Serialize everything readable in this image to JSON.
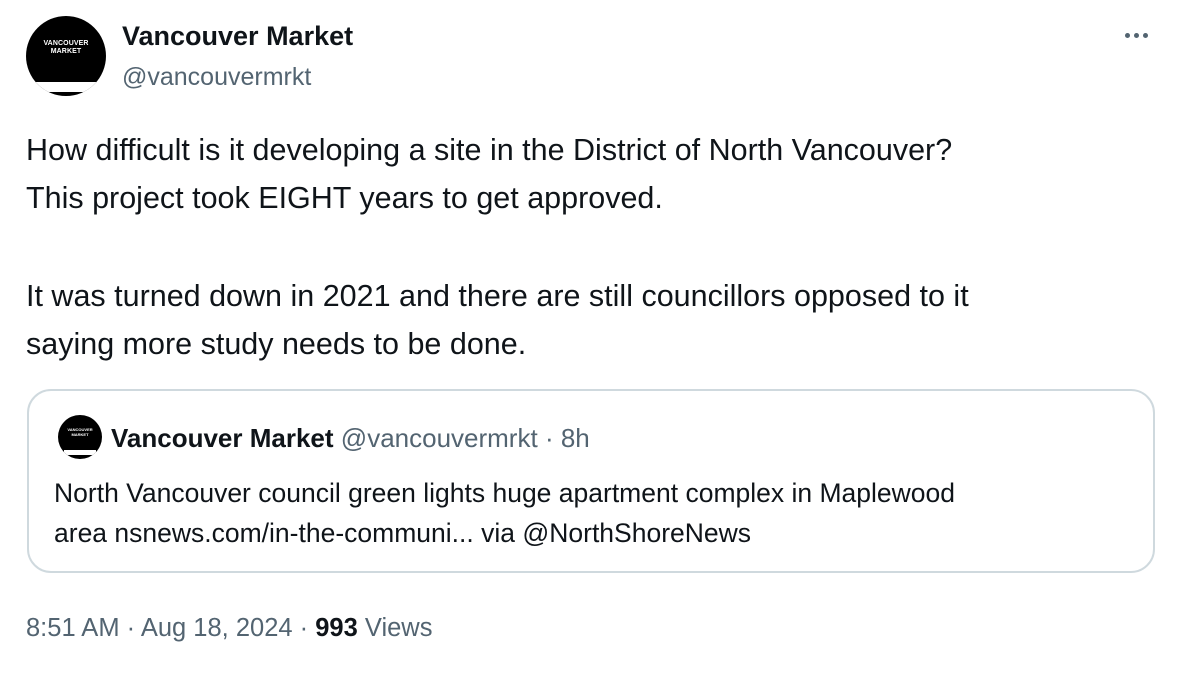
{
  "author": {
    "name": "Vancouver Market",
    "handle": "@vancouvermrkt",
    "avatar_text_line1": "VANCOUVER",
    "avatar_text_line2": "MARKET"
  },
  "more_icon": "more-horizontal-icon",
  "tweet": {
    "paragraphs": [
      [
        "How difficult is it developing a site in the District of North Vancouver?",
        "This project took EIGHT years to get approved."
      ],
      [
        "It was turned down in 2021 and there are still councillors opposed to it",
        "saying more study needs to be done."
      ]
    ]
  },
  "quote": {
    "name": "Vancouver Market",
    "handle": "@vancouvermrkt",
    "separator": "·",
    "time": "8h",
    "lines": [
      "North Vancouver council green lights huge apartment complex in Maplewood",
      "area nsnews.com/in-the-communi... via @NorthShoreNews"
    ]
  },
  "meta": {
    "time": "8:51 AM",
    "separator": "·",
    "date": "Aug 18, 2024",
    "views_count": "993",
    "views_label": "Views"
  },
  "colors": {
    "text": "#0f1419",
    "secondary": "#536471",
    "border": "#cfd9de"
  }
}
